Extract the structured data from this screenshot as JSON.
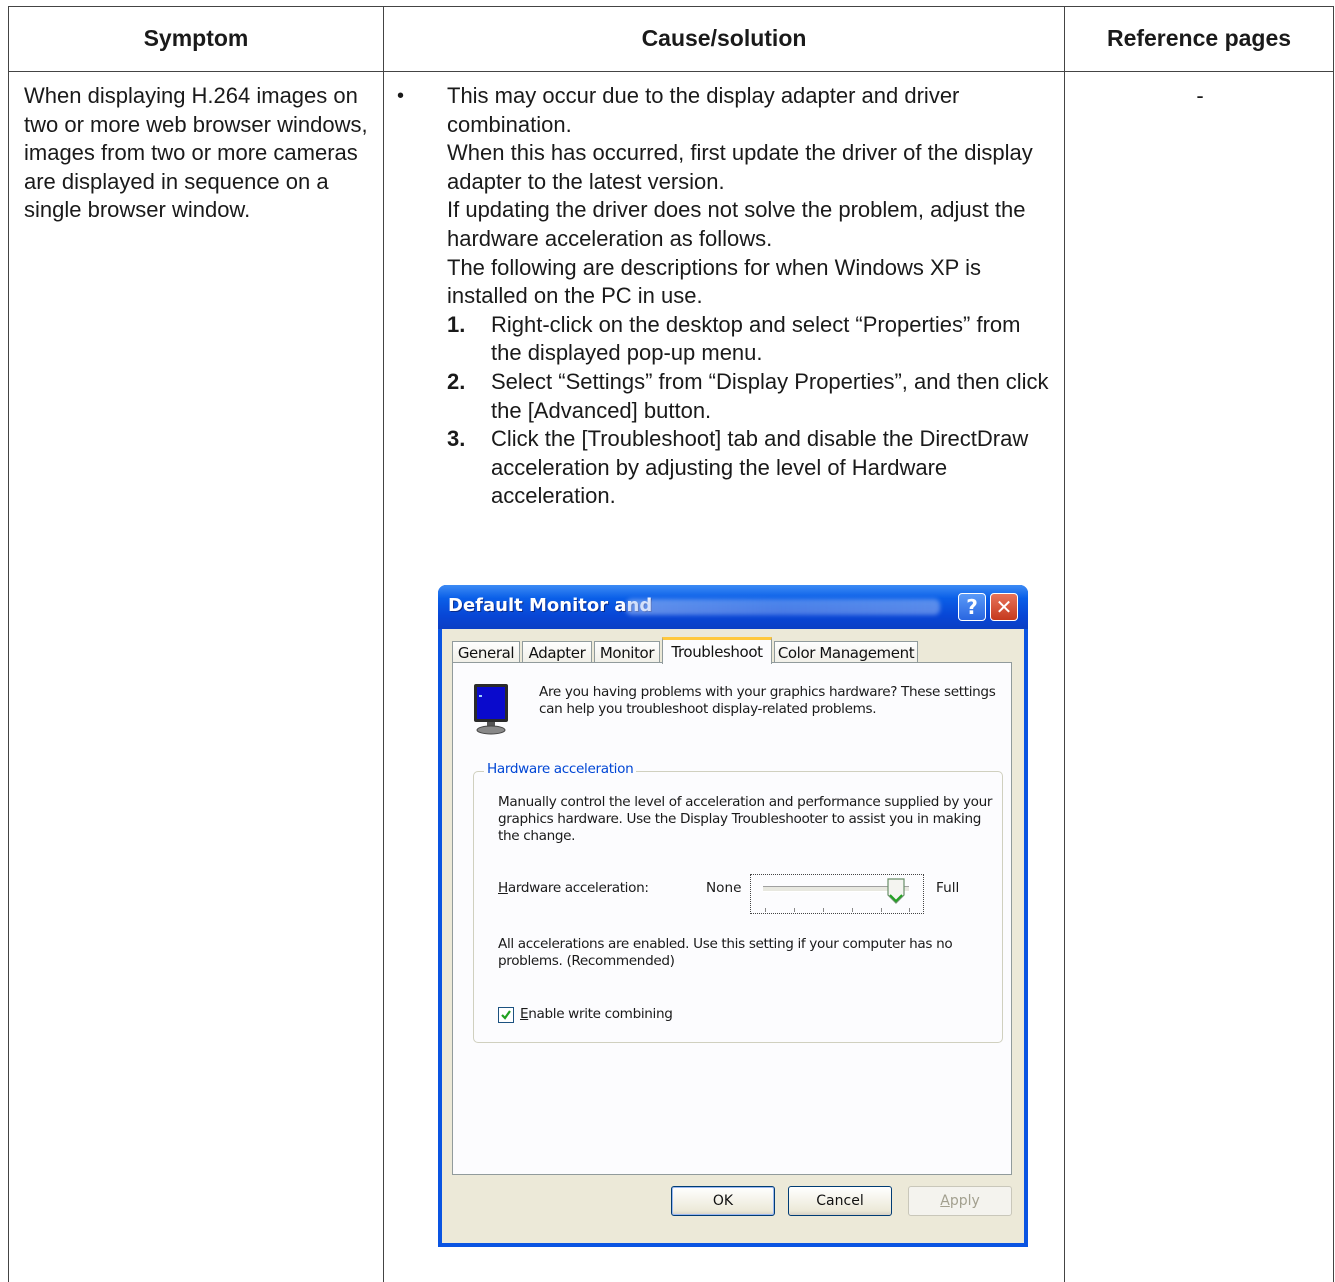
{
  "table": {
    "headers": [
      "Symptom",
      "Cause/solution",
      "Reference pages"
    ],
    "symptom": "When displaying H.264 images on two or more web browser windows, images from two or more cameras are displayed in sequence on a single browser window.",
    "reference": "-",
    "bullet": "•",
    "cause_paragraphs": [
      "This may occur due to the display adapter and driver combination.",
      "When this has occurred, first update the driver of the display adapter to the latest version.",
      "If updating the driver does not solve the problem, adjust the hardware acceleration as follows.",
      "The following are descriptions for when Windows XP is installed on the PC in use."
    ],
    "steps": [
      {
        "num": "1.",
        "text": "Right-click on the desktop and select “Properties” from the displayed pop-up menu."
      },
      {
        "num": "2.",
        "text": "Select “Settings” from “Display Properties”, and then click the [Advanced] button."
      },
      {
        "num": "3.",
        "text": "Click the [Troubleshoot] tab and disable the DirectDraw acceleration by adjusting the level of Hardware acceleration."
      }
    ]
  },
  "dialog": {
    "title": "Default Monitor and",
    "help_icon": "?",
    "close_icon": "✕",
    "tabs": [
      "General",
      "Adapter",
      "Monitor",
      "Troubleshoot",
      "Color Management"
    ],
    "active_tab": "Troubleshoot",
    "intro": "Are you having problems with your graphics hardware? These settings can help you troubleshoot display-related problems.",
    "group_label": "Hardware acceleration",
    "group_desc": "Manually control the level of acceleration and performance supplied by your graphics hardware. Use the Display Troubleshooter to assist you in making the change.",
    "hw_label_first": "H",
    "hw_label_rest": "ardware acceleration:",
    "slider_min_label": "None",
    "slider_max_label": "Full",
    "slider_level": 1.0,
    "status": "All accelerations are enabled. Use this setting if your computer has no problems. (Recommended)",
    "write_combining_first": "E",
    "write_combining_rest": "nable write combining",
    "write_combining_checked": true,
    "buttons": {
      "ok": "OK",
      "cancel": "Cancel",
      "apply_first": "A",
      "apply_rest": "pply"
    }
  },
  "colors": {
    "titlebar": "#0a54e2",
    "dialog_face": "#ece9d8",
    "group_label": "#0046d5",
    "active_tab_accent": "#ffc83c",
    "checkmark": "#21a121"
  }
}
